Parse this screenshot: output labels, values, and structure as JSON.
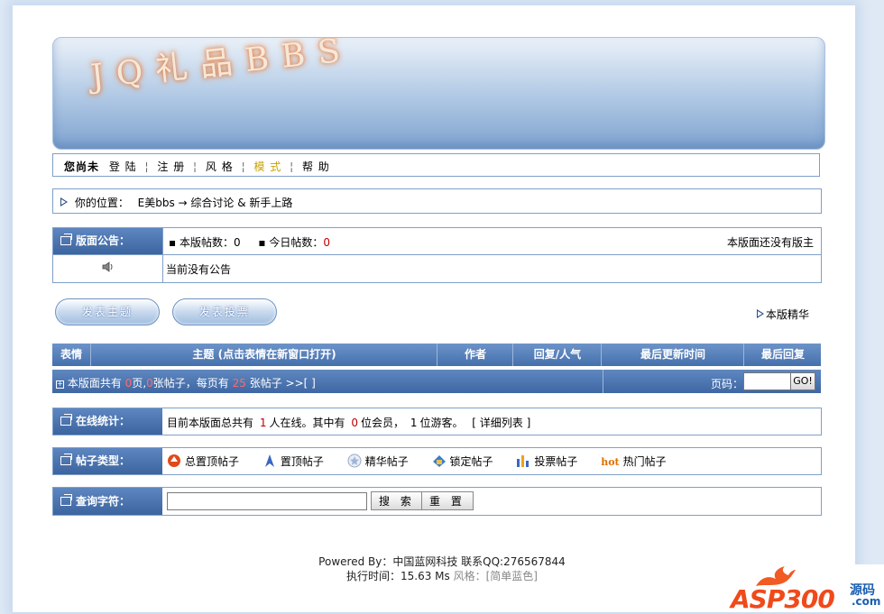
{
  "banner": {
    "title": "JQ礼品BBS"
  },
  "nav": {
    "user_status": "您尚未",
    "items": [
      "登 陆",
      "注 册",
      "风 格",
      "模 式",
      "帮 助"
    ],
    "separator": "¦"
  },
  "location": {
    "label": "你的位置：",
    "path": "E美bbs → 综合讨论 & 新手上路"
  },
  "announcement": {
    "header": "版面公告：",
    "post_count_label": "▪ 本版帖数：",
    "post_count": "0",
    "today_label": "▪ 今日帖数：",
    "today_count": "0",
    "moderator": "本版面还没有版主",
    "content": "当前没有公告"
  },
  "actions": {
    "new_topic": "发表主题",
    "new_poll": "发表投票",
    "essence_link": "本版精华"
  },
  "table": {
    "columns": [
      "表情",
      "主题 (点击表情在新窗口打开)",
      "作者",
      "回复/人气",
      "最后更新时间",
      "最后回复"
    ],
    "summary_prefix": "本版面共有",
    "pages": "0",
    "summary_mid1": "页,",
    "topics": "0",
    "summary_mid2": "张帖子，每页有",
    "per_page": "25",
    "summary_suffix": "张帖子 >>[ ]",
    "page_label": "页码：",
    "go_button": "GO!"
  },
  "online": {
    "header": "在线统计：",
    "text_prefix": "目前本版面总共有",
    "online_count": "1",
    "text_mid1": "人在线。其中有",
    "member_count": "0",
    "text_mid2": "位会员，",
    "guest_count": "1",
    "text_mid3": "位游客。",
    "detail_link": "[ 详细列表 ]"
  },
  "types": {
    "header": "帖子类型：",
    "items": [
      "总置顶帖子",
      "置顶帖子",
      "精华帖子",
      "锁定帖子",
      "投票帖子",
      "热门帖子"
    ],
    "hot_badge": "hot"
  },
  "search": {
    "header": "查询字符：",
    "search_button": "搜 索",
    "reset_button": "重 置",
    "input_value": ""
  },
  "footer": {
    "powered_by": "Powered By：中国蓝网科技 联系QQ:276567844",
    "exec_time": "执行时间：15.63 Ms",
    "style_label": "风格：",
    "style_value": "[简单蓝色]"
  },
  "watermark": {
    "text": "ASP300",
    "suffix": "源码",
    "domain": ".com"
  },
  "colors": {
    "header_blue": "#4470ac",
    "border_blue": "#7fa0c8",
    "highlight_red": "#c00000",
    "mode_yellow": "#c8a000"
  }
}
